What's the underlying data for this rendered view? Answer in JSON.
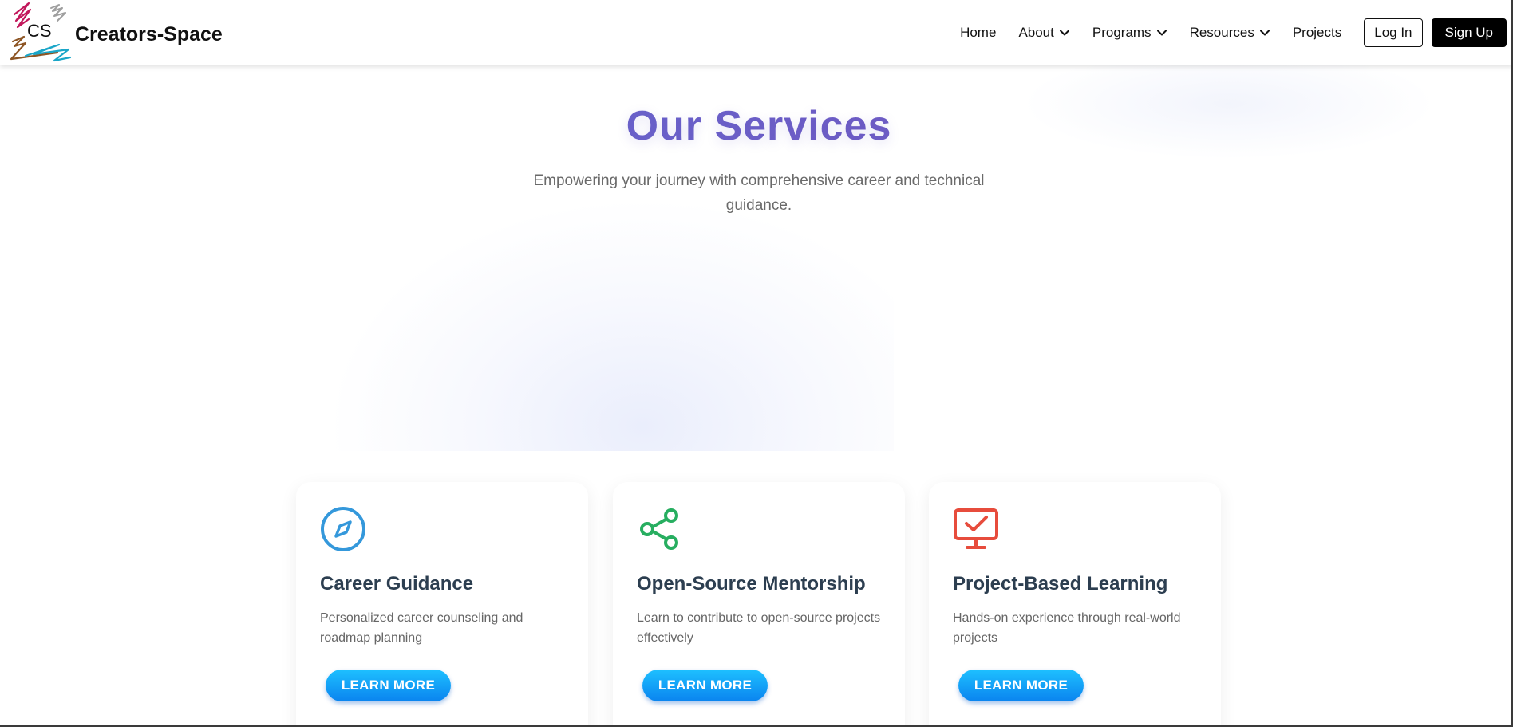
{
  "brand": {
    "logo_text": "CS",
    "name": "Creators-Space"
  },
  "nav": {
    "items": [
      {
        "label": "Home",
        "has_dropdown": false
      },
      {
        "label": "About",
        "has_dropdown": true
      },
      {
        "label": "Programs",
        "has_dropdown": true
      },
      {
        "label": "Resources",
        "has_dropdown": true
      },
      {
        "label": "Projects",
        "has_dropdown": false
      }
    ],
    "login_label": "Log In",
    "signup_label": "Sign Up"
  },
  "hero": {
    "title": "Our Services",
    "subtitle": "Empowering your journey with comprehensive career and technical guidance."
  },
  "cards": [
    {
      "icon": "compass-icon",
      "icon_color": "#3498db",
      "title": "Career Guidance",
      "description": "Personalized career counseling and roadmap planning",
      "button_label": "LEARN MORE"
    },
    {
      "icon": "share-nodes-icon",
      "icon_color": "#27ae60",
      "title": "Open-Source Mentorship",
      "description": "Learn to contribute to open-source projects effectively",
      "button_label": "LEARN MORE"
    },
    {
      "icon": "monitor-check-icon",
      "icon_color": "#e74c3c",
      "title": "Project-Based Learning",
      "description": "Hands-on experience through real-world projects",
      "button_label": "LEARN MORE"
    }
  ],
  "colors": {
    "title_gradient_start": "#5f6fd6",
    "title_gradient_end": "#764ba2",
    "button_gradient_start": "#1ec0ff",
    "button_gradient_end": "#0a84ef",
    "card_title": "#2c3e50"
  }
}
